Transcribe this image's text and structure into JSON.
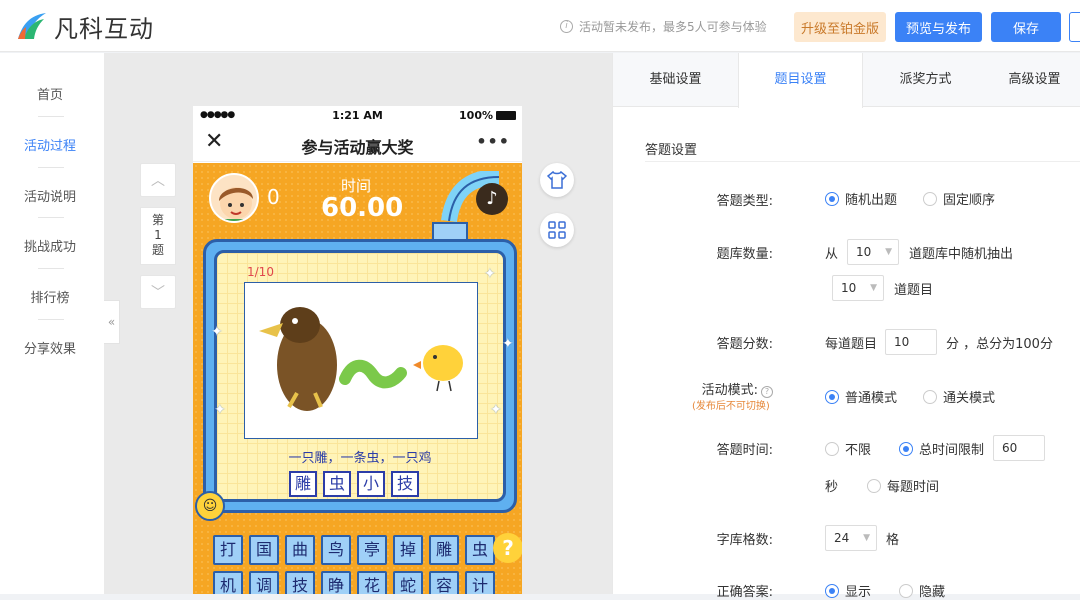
{
  "header": {
    "logo_text": "凡科互动",
    "notice": "活动暂未发布，最多5人可参与体验",
    "upgrade_label": "升级至铂金版",
    "publish_label": "预览与发布",
    "save_label": "保存"
  },
  "leftnav": {
    "items": [
      {
        "label": "首页",
        "active": false
      },
      {
        "label": "活动过程",
        "active": true
      },
      {
        "label": "活动说明",
        "active": false
      },
      {
        "label": "挑战成功",
        "active": false
      },
      {
        "label": "排行榜",
        "active": false
      },
      {
        "label": "分享效果",
        "active": false
      }
    ],
    "collapse_glyph": "«"
  },
  "canvas": {
    "question_label": "第\n1\n题",
    "up_glyph": "︿",
    "down_glyph": "﹀"
  },
  "phone": {
    "status_dots": "●●●●●",
    "status_time": "1:21 AM",
    "status_battery": "100%",
    "nav_close": "✕",
    "nav_title": "参与活动赢大奖",
    "nav_more": "•••",
    "score": "0",
    "time_label": "时间",
    "time_value": "60.00",
    "music_glyph": "♪",
    "progress": "1/10",
    "hint": "一只雕，一条虫，一只鸡",
    "answer_cells": [
      "雕",
      "虫",
      "小",
      "技"
    ],
    "keys": [
      "打",
      "国",
      "曲",
      "鸟",
      "亭",
      "掉",
      "雕",
      "虫",
      "机",
      "调",
      "技",
      "睁",
      "花",
      "蛇",
      "容",
      "计"
    ],
    "help_glyph": "?"
  },
  "rpanel": {
    "tabs": [
      {
        "label": "基础设置",
        "active": false
      },
      {
        "label": "题目设置",
        "active": true
      },
      {
        "label": "派奖方式",
        "active": false
      },
      {
        "label": "高级设置",
        "active": false
      }
    ],
    "section_title": "答题设置",
    "type_label": "答题类型:",
    "type_opt1": "随机出题",
    "type_opt2": "固定顺序",
    "bank_label": "题库数量:",
    "bank_from": "从",
    "bank_sel1": "10",
    "bank_mid": "道题库中随机抽出",
    "bank_sel2": "10",
    "bank_suffix": "道题目",
    "score_label": "答题分数:",
    "score_prefix": "每道题目",
    "score_input": "10",
    "score_suffix": "分 ，总分为100分",
    "mode_label": "活动模式:",
    "mode_sub": "(发布后不可切换)",
    "mode_opt1": "普通模式",
    "mode_opt2": "通关模式",
    "time_label": "答题时间:",
    "time_opt1": "不限",
    "time_opt2": "总时间限制",
    "time_input": "60",
    "time_unit": "秒",
    "time_opt3": "每题时间",
    "grid_label": "字库格数:",
    "grid_sel": "24",
    "grid_unit": "格",
    "correct_label": "正确答案:",
    "correct_opt1": "显示",
    "correct_opt2": "隐藏"
  },
  "colors": {
    "accent": "#3b82f6",
    "upgrade_bg": "#fde8cf",
    "game_bg": "#f6a623",
    "board_border": "#2c5fa8"
  }
}
